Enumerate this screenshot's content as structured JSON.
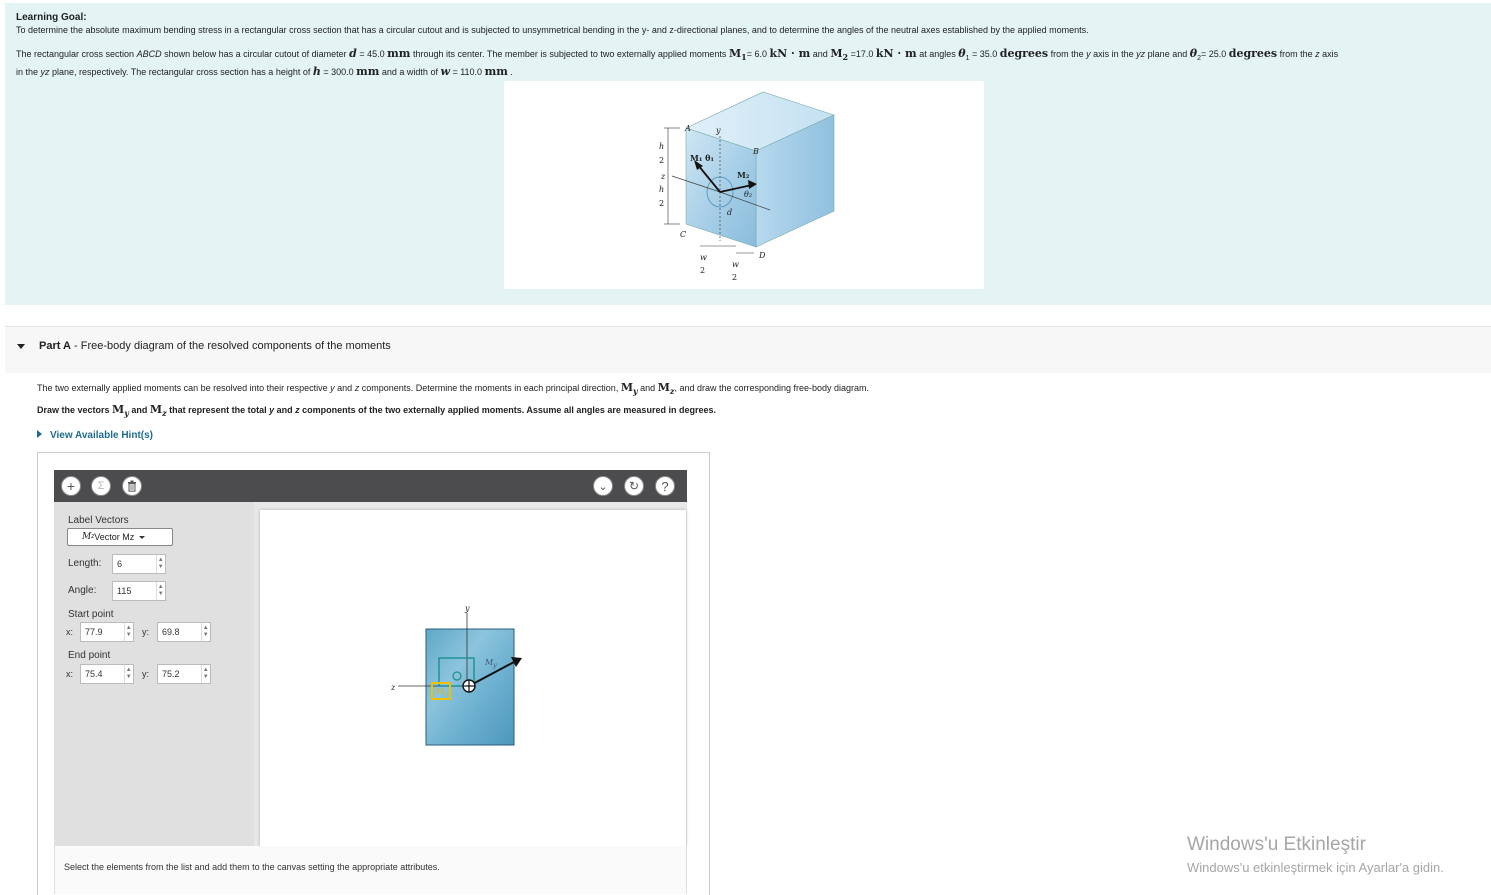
{
  "learning_goal": {
    "title": "Learning Goal:",
    "text": "To determine the absolute maximum bending stress in a rectangular cross section that has a circular cutout and is subjected to unsymmetrical bending in the y- and z-directional planes, and to determine the angles of the neutral axes established by the applied moments.",
    "para": {
      "p1": "The rectangular cross section ",
      "abcd": "ABCD",
      "p2": " shown below has a circular cutout of diameter ",
      "d_sym": "d",
      "d_val": " = 45.0 ",
      "d_unit": "mm",
      "p3": " through its center. The member is subjected to two externally applied moments ",
      "m1_sym": "M",
      "m1_sub": "1",
      "m1_val": "= 6.0 ",
      "m1_unit": "kN · m",
      "and1": " and ",
      "m2_sym": "M",
      "m2_sub": "2",
      "m2_val": " =17.0 ",
      "m2_unit": "kN · m",
      "p4": " at angles ",
      "t1_sym": "θ",
      "t1_sub": "1",
      "t1_val": " = 35.0 ",
      "t1_unit": "degrees",
      "p5": " from the ",
      "y_ital": "y",
      "p6": " axis in the ",
      "yz_ital": "yz",
      "p7": " plane and ",
      "t2_sym": "θ",
      "t2_sub": "2",
      "t2_val": "= 25.0 ",
      "t2_unit": "degrees",
      "p8": " from the ",
      "z_ital": "z",
      "p9": " axis",
      "p10": "in the ",
      "yz2_ital": "yz",
      "p11": " plane, respectively. The rectangular cross section has a height of ",
      "h_sym": "h",
      "h_val": " = 300.0 ",
      "h_unit": "mm",
      "p12": " and a width of ",
      "w_sym": "w",
      "w_val": " = 110.0 ",
      "w_unit": "mm",
      "p13": " ."
    },
    "figure": {
      "label_A": "A",
      "label_B": "B",
      "label_C": "C",
      "label_D": "D",
      "label_y": "y",
      "label_z": "z",
      "label_d": "d",
      "h": "h",
      "two": "2",
      "w": "w",
      "m1_label": "M₁ θ₁",
      "m2_label": "M₂",
      "theta2": "θ₂"
    }
  },
  "part_a": {
    "part": "Part A",
    "title": " - Free-body diagram of the resolved components of the moments",
    "intro_a": "The two externally applied moments can be resolved into their respective ",
    "intro_y": "y",
    "intro_b": " and ",
    "intro_z": "z",
    "intro_c": " components. Determine the moments in each principal direction, ",
    "intro_my": "M",
    "intro_my_sub": "y",
    "intro_and": " and ",
    "intro_mz": "M",
    "intro_mz_sub": "z",
    "intro_d": ", and draw the corresponding free-body diagram.",
    "draw_a": "Draw the vectors ",
    "draw_my": "M",
    "draw_my_sub": "y",
    "draw_and": " and ",
    "draw_mz": "M",
    "draw_mz_sub": "z",
    "draw_b": " that represent the total ",
    "draw_y": "y",
    "draw_c": " and ",
    "draw_z": "z",
    "draw_d": " components of the two externally applied moments. Assume all angles are measured in degrees.",
    "hint": "View Available Hint(s)"
  },
  "toolbar": {
    "add_icon": "+",
    "sigma_icon": "Σ",
    "chevron_icon": "⌄",
    "reset_icon": "↻",
    "help_icon": "?"
  },
  "panel": {
    "label_vectors": "Label Vectors",
    "dropdown_prefix": "M",
    "dropdown_sub": "z",
    "dropdown_value": " Vector Mz",
    "length_label": "Length:",
    "length_value": "6",
    "angle_label": "Angle:",
    "angle_value": "115",
    "start_label": "Start point",
    "end_label": "End point",
    "x_label": "x:",
    "y_label": "y:",
    "start_x": "77.9",
    "start_y": "69.8",
    "end_x": "75.4",
    "end_y": "75.2"
  },
  "canvas": {
    "y_axis_label": "y",
    "z_axis_label": "z",
    "my_label": "M",
    "my_sub": "y",
    "mz_label": "M",
    "mz_sub": "z"
  },
  "footer": {
    "text": "Select the elements from the list and add them to the canvas setting the appropriate attributes."
  },
  "watermark": {
    "line1": "Windows'u Etkinleştir",
    "line2": "Windows'u etkinleştirmek için Ayarlar'a gidin."
  }
}
